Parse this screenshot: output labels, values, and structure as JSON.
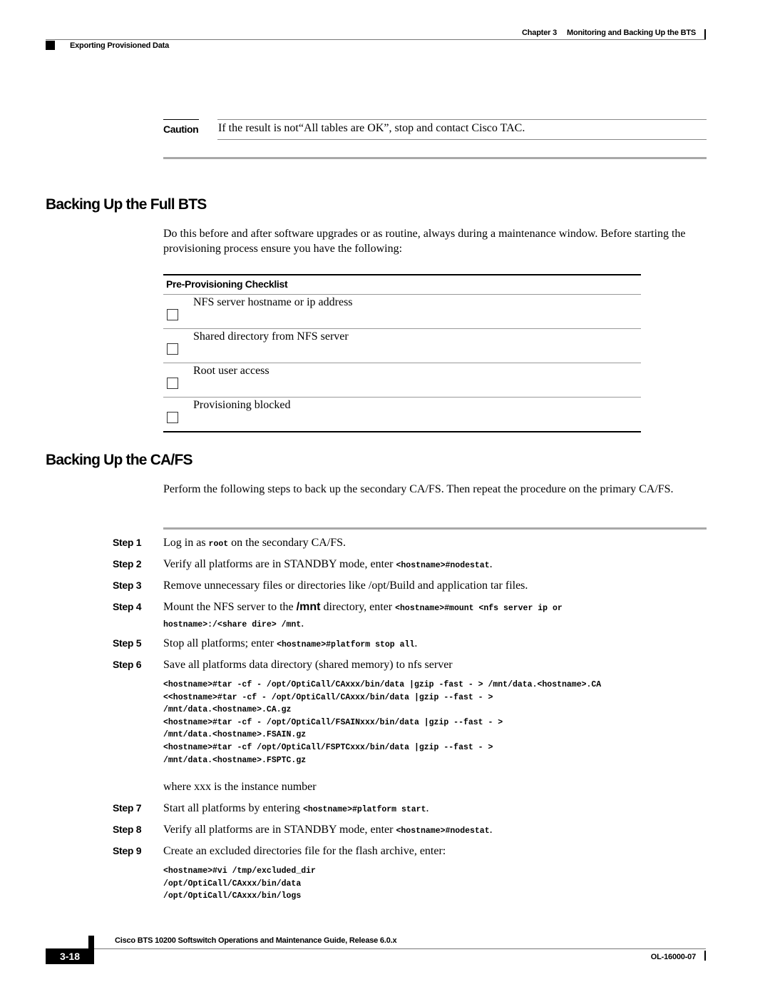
{
  "header": {
    "chapter_label": "Chapter 3",
    "chapter_title": "Monitoring and Backing Up the BTS",
    "section": "Exporting Provisioned Data"
  },
  "caution": {
    "label": "Caution",
    "text": "If the result is not“All tables are OK”, stop and contact Cisco TAC."
  },
  "full_bts": {
    "heading": "Backing Up the Full BTS",
    "intro": "Do this before and after software upgrades or as routine, always during a maintenance window. Before starting the provisioning process ensure you have the following:",
    "checklist": {
      "title": "Pre-Provisioning Checklist",
      "items": [
        {
          "label": "NFS server hostname or ip address",
          "checked": false
        },
        {
          "label": "Shared directory from NFS server",
          "checked": false
        },
        {
          "label": "Root user access",
          "checked": false
        },
        {
          "label": "Provisioning blocked",
          "checked": false
        }
      ]
    }
  },
  "cafs": {
    "heading": "Backing Up the CA/FS",
    "intro": "Perform the following steps to back up the secondary CA/FS. Then repeat the procedure on the primary CA/FS.",
    "steps": [
      {
        "label": "Step 1",
        "pre": "Log in as ",
        "cmd": "root",
        "post": " on the secondary CA/FS."
      },
      {
        "label": "Step 2",
        "pre": "Verify all platforms are in STANDBY mode, enter ",
        "cmd": "<hostname>#nodestat",
        "post": "."
      },
      {
        "label": "Step 3",
        "pre": "Remove unnecessary files or directories like /opt/Build and application tar files.",
        "cmd": "",
        "post": ""
      },
      {
        "label": "Step 4",
        "pre": "Mount the NFS server to the ",
        "bold": "/mnt",
        "mid": " directory, enter ",
        "cmd": "<hostname>#mount <nfs server ip or hostname>:/<share dire> /mnt",
        "post": "."
      },
      {
        "label": "Step 5",
        "pre": "Stop all platforms; enter ",
        "cmd": "<hostname>#platform stop all",
        "post": "."
      },
      {
        "label": "Step 6",
        "pre": "Save all platforms data directory (shared memory) to nfs server",
        "cmd": "",
        "post": ""
      },
      {
        "label": "Step 7",
        "pre": "Start all platforms by entering ",
        "cmd": "<hostname>#platform start",
        "post": "."
      },
      {
        "label": "Step 8",
        "pre": "Verify all platforms are in STANDBY mode, enter ",
        "cmd": "<hostname>#nodestat",
        "post": "."
      },
      {
        "label": "Step 9",
        "pre": "Create an excluded directories file for the flash archive, enter:",
        "cmd": "",
        "post": ""
      }
    ],
    "step6_code": [
      "<hostname>#tar -cf - /opt/OptiCall/CAxxx/bin/data |gzip -fast - > /mnt/data.<hostname>.CA",
      "<<hostname>#tar -cf - /opt/OptiCall/CAxxx/bin/data |gzip --fast - >",
      "/mnt/data.<hostname>.CA.gz",
      "<hostname>#tar -cf - /opt/OptiCall/FSAINxxx/bin/data |gzip --fast - >",
      "/mnt/data.<hostname>.FSAIN.gz",
      "<hostname>#tar -cf /opt/OptiCall/FSPTCxxx/bin/data |gzip --fast - >",
      "/mnt/data.<hostname>.FSPTC.gz"
    ],
    "step6_note": "where xxx is the instance number",
    "step9_code": [
      "<hostname>#vi /tmp/excluded_dir",
      "/opt/OptiCall/CAxxx/bin/data",
      "/opt/OptiCall/CAxxx/bin/logs"
    ]
  },
  "footer": {
    "title": "Cisco BTS 10200 Softswitch Operations and Maintenance Guide, Release 6.0.x",
    "page": "3-18",
    "doc_id": "OL-16000-07"
  }
}
